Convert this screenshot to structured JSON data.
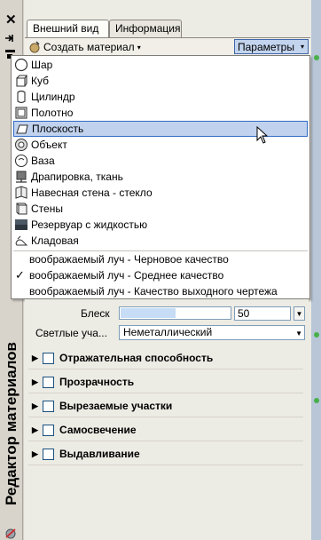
{
  "sidebar": {
    "close_glyph": "✕",
    "title": "Редактор материалов"
  },
  "tabs": [
    {
      "label": "Внешний вид",
      "active": true
    },
    {
      "label": "Информация",
      "active": false
    }
  ],
  "toolbar": {
    "create_label": "Создать материал",
    "params_label": "Параметры"
  },
  "menu": {
    "items": [
      {
        "label": "Шар",
        "icon": "sphere-icon"
      },
      {
        "label": "Куб",
        "icon": "cube-icon"
      },
      {
        "label": "Цилиндр",
        "icon": "cylinder-icon"
      },
      {
        "label": "Полотно",
        "icon": "canvas-icon"
      },
      {
        "label": "Плоскость",
        "icon": "plane-icon",
        "highlighted": true
      },
      {
        "label": "Объект",
        "icon": "object-icon"
      },
      {
        "label": "Ваза",
        "icon": "vase-icon"
      },
      {
        "label": "Драпировка, ткань",
        "icon": "drapery-icon"
      },
      {
        "label": "Навесная стена - стекло",
        "icon": "curtain-wall-icon"
      },
      {
        "label": "Стены",
        "icon": "walls-icon"
      },
      {
        "label": "Резервуар с жидкостью",
        "icon": "liquid-tank-icon"
      },
      {
        "label": "Кладовая",
        "icon": "utility-icon"
      }
    ],
    "quality_items": [
      {
        "label": "воображаемый луч - Черновое качество",
        "checked": false
      },
      {
        "label": "воображаемый луч - Среднее качество",
        "checked": true
      },
      {
        "label": "воображаемый луч - Качество выходного чертежа",
        "checked": false
      }
    ],
    "check_glyph": "✓"
  },
  "panel": {
    "gloss_label": "Блеск",
    "gloss_value": "50",
    "gloss_fraction": 0.5,
    "highlights_label": "Светлые уча...",
    "highlights_value": "Неметаллический",
    "sections": [
      {
        "label": "Отражательная способность"
      },
      {
        "label": "Прозрачность"
      },
      {
        "label": "Вырезаемые участки"
      },
      {
        "label": "Самосвечение"
      },
      {
        "label": "Выдавливание"
      }
    ]
  },
  "colors": {
    "highlight": "#c1d2ee",
    "highlight_border": "#316ac5",
    "panel_bg": "#ecebe4"
  }
}
